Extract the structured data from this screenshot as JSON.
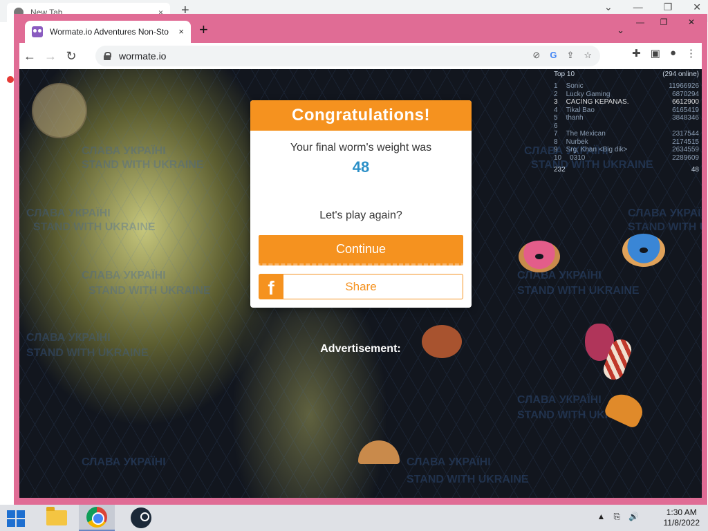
{
  "background_browser": {
    "tab_title": "New Tab",
    "tab_close": "×",
    "new_tab": "+",
    "controls": [
      "⌄",
      "—",
      "❐",
      "✕"
    ]
  },
  "browser": {
    "tab_title": "Wormate.io Adventures Non-Sto",
    "tab_close": "×",
    "new_tab": "+",
    "tab_search": "⌄",
    "window_controls": {
      "minimize": "—",
      "restore": "❐",
      "close": "✕"
    },
    "nav": {
      "back": "←",
      "forward": "→",
      "reload": "↻"
    },
    "url": "wormate.io",
    "omnibox_icons": {
      "blocked": "⊘",
      "google": "G",
      "share": "⇪",
      "bookmark": "☆"
    },
    "toolbar_icons": {
      "extensions": "✚",
      "side_panel": "▣",
      "profile": "●",
      "menu": "⋮"
    }
  },
  "game": {
    "leaderboard": {
      "title": "Top 10",
      "online": "(294 online)",
      "rows": [
        {
          "rank": "1",
          "name": "Sonic",
          "score": "11966926"
        },
        {
          "rank": "2",
          "name": "Lucky Gaming",
          "score": "6870294"
        },
        {
          "rank": "3",
          "name": "CACING KEPANAS.",
          "score": "6612900"
        },
        {
          "rank": "4",
          "name": "Tikal Bao",
          "score": "6165419"
        },
        {
          "rank": "5",
          "name": "thanh",
          "score": "3848346"
        },
        {
          "rank": "6",
          "name": "",
          "score": ""
        },
        {
          "rank": "7",
          "name": "The Mexican",
          "score": "2317544"
        },
        {
          "rank": "8",
          "name": "Nurbek",
          "score": "2174515"
        },
        {
          "rank": "9",
          "name": "Srg. Khan <Big dik>",
          "score": "2634559"
        },
        {
          "rank": "10",
          "name": "0310",
          "score": "2289609"
        }
      ],
      "footer_left": "232",
      "footer_right": "48"
    },
    "watermark_texts": [
      "СЛАВА УКРАЇНІ",
      "STAND WITH UKRAINE"
    ],
    "ad_label": "Advertisement:"
  },
  "dialog": {
    "title": "Congratulations!",
    "message": "Your final worm's weight was",
    "score": "48",
    "prompt": "Let's play again?",
    "continue_label": "Continue",
    "share_label": "Share",
    "fb_icon": "f"
  },
  "taskbar": {
    "time": "1:30 AM",
    "date": "11/8/2022",
    "tray_icons": [
      "▲",
      "⎘",
      "🔊"
    ]
  },
  "colors": {
    "accent_orange": "#f5921f",
    "score_blue": "#2a8fc7",
    "frame_pink": "#e06c95"
  }
}
